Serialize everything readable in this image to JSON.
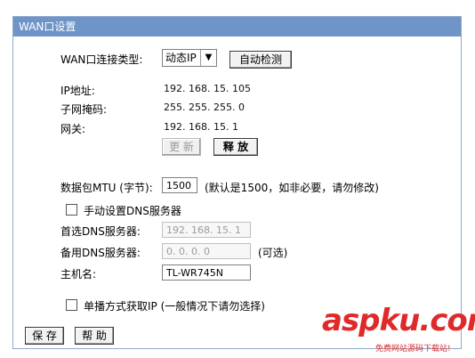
{
  "window": {
    "title": "WAN口设置"
  },
  "wan_type": {
    "label": "WAN口连接类型:",
    "selected": "动态IP",
    "detect_button": "自动检测"
  },
  "status": {
    "ip_label": "IP地址:",
    "ip_value": "192. 168. 15. 105",
    "mask_label": "子网掩码:",
    "mask_value": "255. 255. 255. 0",
    "gateway_label": "网关:",
    "gateway_value": "192. 168. 15. 1",
    "renew_button": "更 新",
    "release_button": "释 放"
  },
  "mtu": {
    "label": "数据包MTU (字节):",
    "value": "1500",
    "hint": "(默认是1500，如非必要，请勿修改)"
  },
  "dns": {
    "manual_label": "手动设置DNS服务器",
    "primary_label": "首选DNS服务器:",
    "primary_value": "192. 168. 15. 1",
    "secondary_label": "备用DNS服务器:",
    "secondary_value": "0. 0. 0. 0",
    "secondary_hint": "(可选)"
  },
  "hostname": {
    "label": "主机名:",
    "value": "TL-WR745N"
  },
  "unicast": {
    "label": "单播方式获取IP (一般情况下请勿选择)"
  },
  "footer": {
    "save_button": "保 存",
    "help_button": "帮 助"
  },
  "watermark": {
    "brand": "aspku.com",
    "tagline": "免费网站源码下载站!"
  },
  "colors": {
    "titlebar": "#6f94c8",
    "watermark": "#e02a2a"
  }
}
